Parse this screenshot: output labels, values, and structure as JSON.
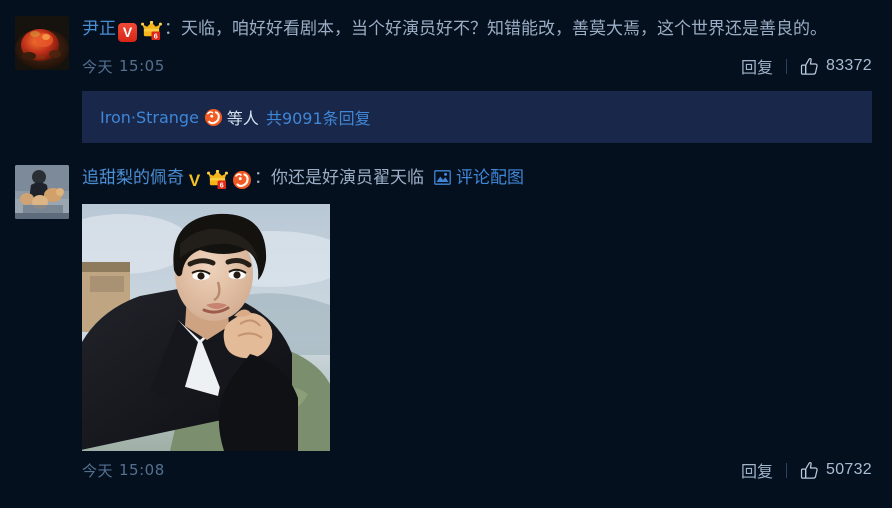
{
  "theme": {
    "page_background": "#05101f",
    "reply_block_background": "#19284a",
    "link_color": "#3f86d6",
    "text_color": "#9aadc4",
    "badge_red": "#d62516",
    "badge_gold": "#f5c021"
  },
  "comments": [
    {
      "id": "comment-1",
      "avatar_name": "avatar-food-dish",
      "username": "尹正",
      "badges": [
        "verified-v-red-badge",
        "crown-level-6-badge"
      ],
      "separator": "：",
      "text": "天临，咱好好看剧本，当个好演员好不？知错能改，善莫大焉，这个世界还是善良的。",
      "time_label": "今天",
      "time_value": "15:05",
      "reply_label": "回复",
      "like_count": "83372",
      "sub_reply": {
        "name": "Iron·Strange",
        "icon": "tiger-face-icon",
        "etc_label": "等人",
        "count_label": "共9091条回复"
      }
    },
    {
      "id": "comment-2",
      "avatar_name": "avatar-person-with-dogs",
      "username": "追甜梨的佩奇",
      "badges": [
        "verified-v-gold-badge",
        "crown-level-6-badge",
        "tiger-face-badge"
      ],
      "separator": "：",
      "text": "你还是好演员翟天临",
      "image_link_label": "评论配图",
      "attached_image_name": "portrait-man-in-black-suit",
      "time_label": "今天",
      "time_value": "15:08",
      "reply_label": "回复",
      "like_count": "50732"
    }
  ]
}
